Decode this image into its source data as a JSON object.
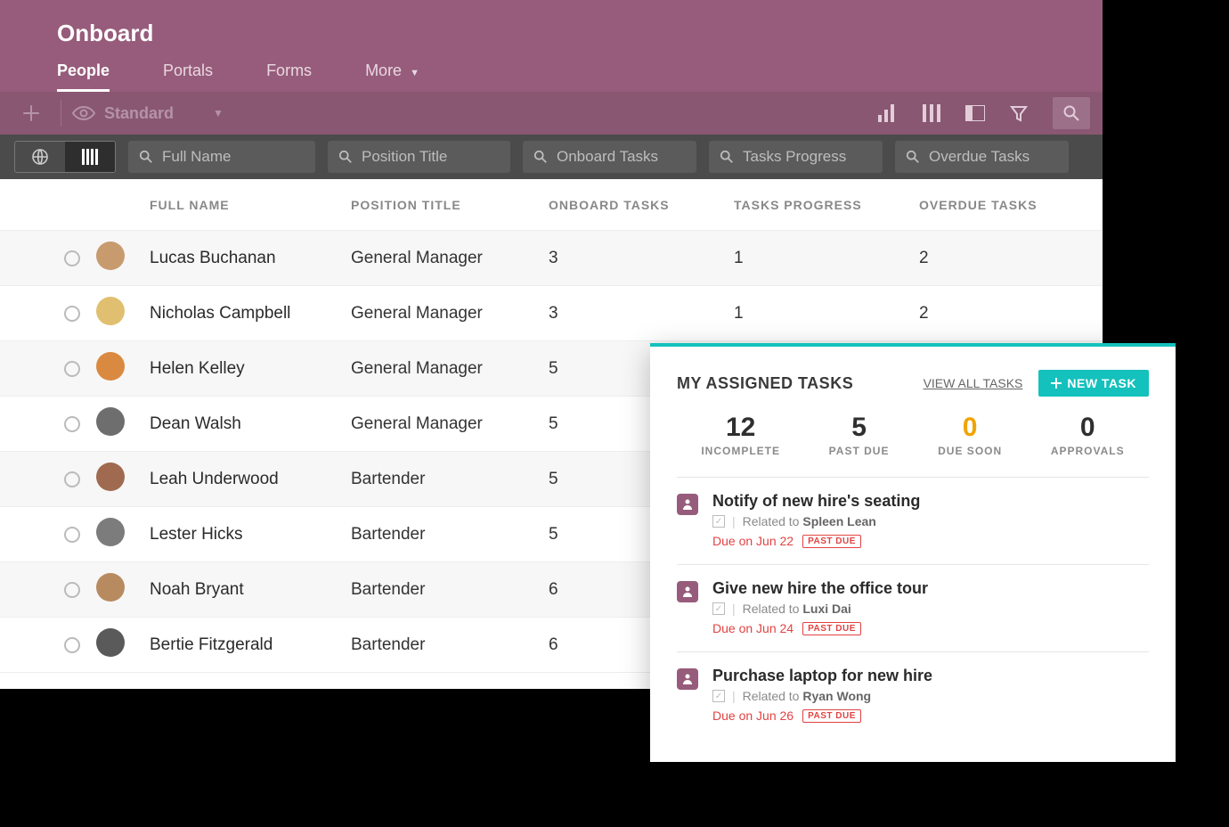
{
  "header": {
    "title": "Onboard",
    "tabs": [
      "People",
      "Portals",
      "Forms",
      "More"
    ],
    "activeTab": 0,
    "viewName": "Standard"
  },
  "filters": {
    "placeholders": [
      "Full Name",
      "Position Title",
      "Onboard Tasks",
      "Tasks Progress",
      "Overdue Tasks"
    ]
  },
  "columns": [
    "FULL NAME",
    "POSITION TITLE",
    "ONBOARD TASKS",
    "TASKS PROGRESS",
    "OVERDUE TASKS"
  ],
  "rows": [
    {
      "name": "Lucas Buchanan",
      "position": "General Manager",
      "onboard": "3",
      "progress": "1",
      "overdue": "2",
      "avatar": "#c89b6e"
    },
    {
      "name": "Nicholas Campbell",
      "position": "General Manager",
      "onboard": "3",
      "progress": "1",
      "overdue": "2",
      "avatar": "#e0c070"
    },
    {
      "name": "Helen Kelley",
      "position": "General Manager",
      "onboard": "5",
      "progress": "",
      "overdue": "",
      "avatar": "#d98a40"
    },
    {
      "name": "Dean Walsh",
      "position": "General Manager",
      "onboard": "5",
      "progress": "",
      "overdue": "",
      "avatar": "#6e6e6e"
    },
    {
      "name": "Leah Underwood",
      "position": "Bartender",
      "onboard": "5",
      "progress": "",
      "overdue": "",
      "avatar": "#a06a50"
    },
    {
      "name": "Lester Hicks",
      "position": "Bartender",
      "onboard": "5",
      "progress": "",
      "overdue": "",
      "avatar": "#7c7c7c"
    },
    {
      "name": "Noah Bryant",
      "position": "Bartender",
      "onboard": "6",
      "progress": "",
      "overdue": "",
      "avatar": "#b88a60"
    },
    {
      "name": "Bertie Fitzgerald",
      "position": "Bartender",
      "onboard": "6",
      "progress": "",
      "overdue": "",
      "avatar": "#5a5a5a"
    }
  ],
  "panel": {
    "title": "MY ASSIGNED TASKS",
    "viewAll": "VIEW ALL TASKS",
    "newTask": "NEW TASK",
    "stats": [
      {
        "num": "12",
        "label": "INCOMPLETE"
      },
      {
        "num": "5",
        "label": "PAST DUE"
      },
      {
        "num": "0",
        "label": "DUE SOON",
        "highlight": true
      },
      {
        "num": "0",
        "label": "APPROVALS"
      }
    ],
    "relatedPrefix": "Related to",
    "duePrefix": "Due on",
    "pastDueBadge": "PAST DUE",
    "tasks": [
      {
        "title": "Notify of new hire's seating",
        "person": "Spleen Lean",
        "due": "Jun 22"
      },
      {
        "title": "Give new hire the office tour",
        "person": "Luxi Dai",
        "due": "Jun 24"
      },
      {
        "title": "Purchase laptop for new hire",
        "person": "Ryan Wong",
        "due": "Jun 26"
      }
    ]
  }
}
